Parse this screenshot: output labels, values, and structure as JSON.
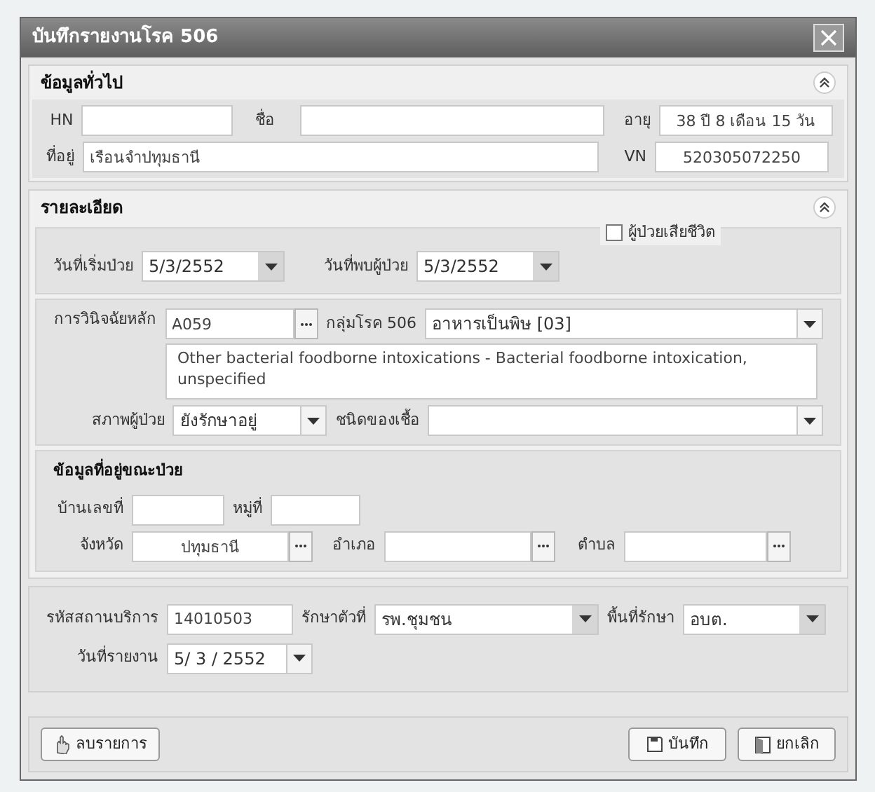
{
  "window": {
    "title": "บันทึกรายงานโรค 506"
  },
  "general": {
    "title": "ข้อมูลทั่วไป",
    "expanded": true,
    "hn": {
      "label": "HN"
    },
    "name": {
      "label": "ชื่อ"
    },
    "age": {
      "label": "อายุ",
      "value": "38 ปี 8 เดือน 15 วัน"
    },
    "address": {
      "label": "ที่อยู่",
      "value": "เรือนจำปทุมธานี"
    },
    "vn": {
      "label": "VN",
      "value": "520305072250"
    }
  },
  "detail": {
    "title": "รายละเอียด",
    "expanded": true,
    "deceased": {
      "label": "ผู้ป่วยเสียชีวิต",
      "checked": false
    },
    "onset_date": {
      "label": "วันที่เริ่มป่วย",
      "value": "5/3/2552"
    },
    "found_date": {
      "label": "วันที่พบผู้ป่วย",
      "value": "5/3/2552"
    },
    "diagnosis": {
      "label": "การวินิจฉัยหลัก",
      "value": "A059"
    },
    "disease_group": {
      "label": "กลุ่มโรค 506",
      "value": "อาหารเป็นพิษ [03]"
    },
    "diagnosis_description": "Other bacterial foodborne intoxications - Bacterial foodborne intoxication, unspecified",
    "patient_status": {
      "label": "สภาพผู้ป่วย",
      "value": "ยังรักษาอยู่"
    },
    "organism": {
      "label": "ชนิดของเชื้อ"
    },
    "illness_address": {
      "title": "ข้อมูลที่อยู่ขณะป่วย",
      "house_no": {
        "label": "บ้านเลขที่"
      },
      "moo": {
        "label": "หมู่ที่"
      },
      "province": {
        "label": "จังหวัด",
        "value": "ปทุมธานี"
      },
      "district": {
        "label": "อำเภอ"
      },
      "subdistrict": {
        "label": "ตำบล"
      }
    }
  },
  "service": {
    "facility_code": {
      "label": "รหัสสถานบริการ",
      "value": "14010503"
    },
    "treated_at": {
      "label": "รักษาตัวที่",
      "value": "รพ.ชุมชน"
    },
    "treatment_area": {
      "label": "พื้นที่รักษา",
      "value": "อบต."
    },
    "report_date": {
      "label": "วันที่รายงาน",
      "value": "5/ 3 / 2552"
    }
  },
  "buttons": {
    "delete": "ลบรายการ",
    "save": "บันทึก",
    "cancel": "ยกเลิก"
  }
}
